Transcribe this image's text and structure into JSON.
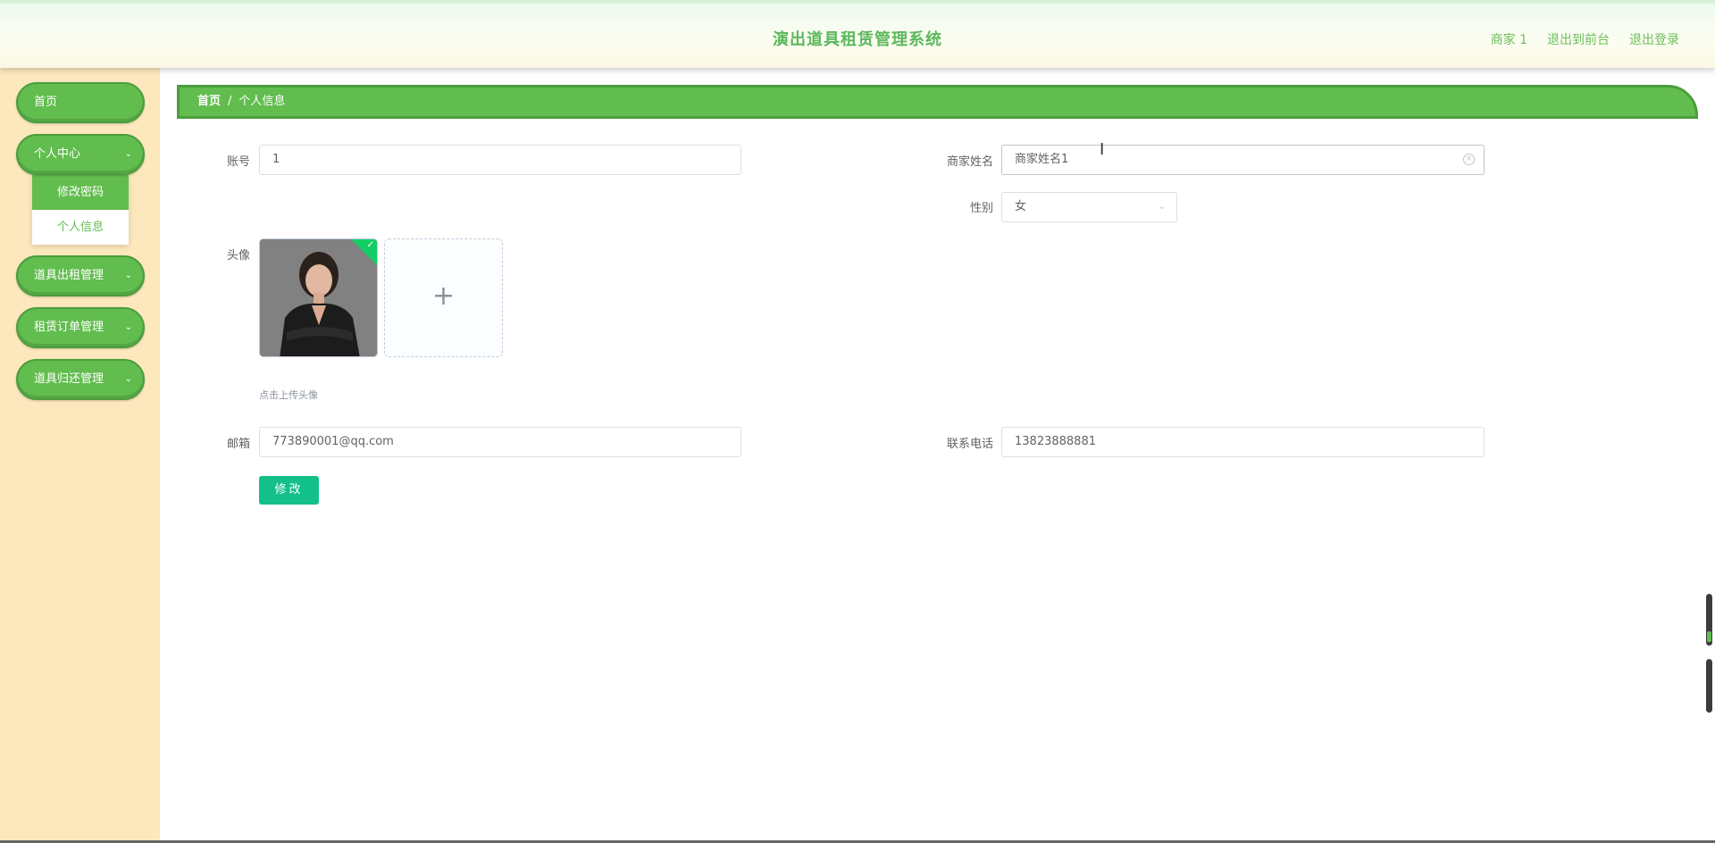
{
  "header": {
    "title": "演出道具租赁管理系统",
    "user": "商家 1",
    "back_to_front": "退出到前台",
    "logout": "退出登录"
  },
  "sidebar": {
    "items": [
      {
        "label": "首页"
      },
      {
        "label": "个人中心",
        "chevron": "chevron-down-icon"
      },
      {
        "label": "道具出租管理",
        "chevron": "chevron-down-icon"
      },
      {
        "label": "租赁订单管理",
        "chevron": "chevron-down-icon"
      },
      {
        "label": "道具归还管理",
        "chevron": "chevron-down-icon"
      }
    ],
    "submenu": [
      "修改密码",
      "个人信息"
    ]
  },
  "breadcrumb": {
    "home": "首页",
    "separator": "/",
    "current": "个人信息"
  },
  "form": {
    "account_label": "账号",
    "account_value": "1",
    "name_label": "商家姓名",
    "name_value": "商家姓名1",
    "gender_label": "性别",
    "gender_value": "女",
    "avatar_label": "头像",
    "upload_plus": "+",
    "upload_tip": "点击上传头像",
    "email_label": "邮箱",
    "email_value": "773890001@qq.com",
    "phone_label": "联系电话",
    "phone_value": "13823888881",
    "submit_label": "修改"
  },
  "colors": {
    "accent": "#62bd4f",
    "sidebar_bg": "#fde8bd",
    "submit": "#13c08a"
  }
}
